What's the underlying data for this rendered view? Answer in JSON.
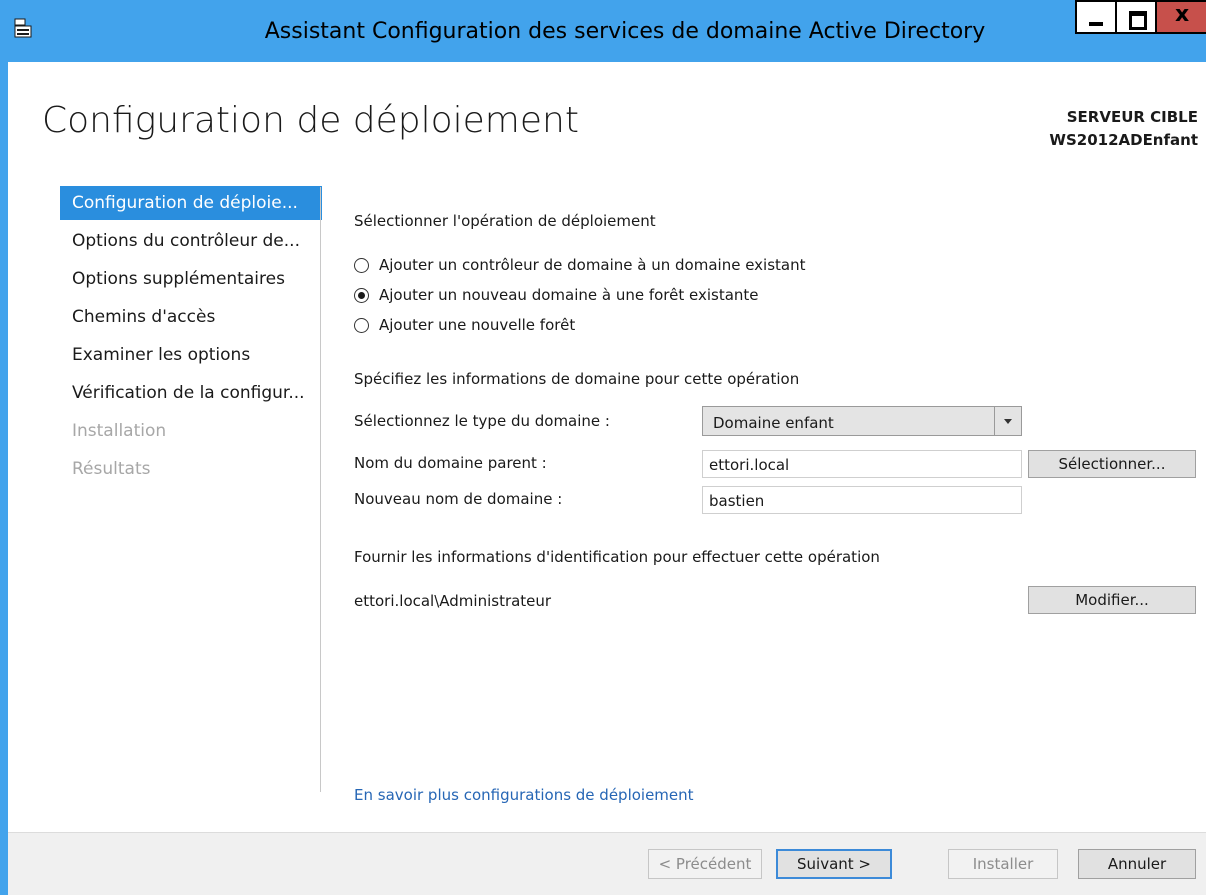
{
  "window": {
    "title": "Assistant Configuration des services de domaine Active Directory",
    "close_glyph": "x"
  },
  "header": {
    "page_title": "Configuration de déploiement",
    "target_label": "SERVEUR CIBLE",
    "target_name": "WS2012ADEnfant"
  },
  "nav": {
    "items": [
      {
        "label": "Configuration de déploie...",
        "state": "selected"
      },
      {
        "label": "Options du contrôleur de...",
        "state": "normal"
      },
      {
        "label": "Options supplémentaires",
        "state": "normal"
      },
      {
        "label": "Chemins d'accès",
        "state": "normal"
      },
      {
        "label": "Examiner les options",
        "state": "normal"
      },
      {
        "label": "Vérification de la configur...",
        "state": "normal"
      },
      {
        "label": "Installation",
        "state": "disabled"
      },
      {
        "label": "Résultats",
        "state": "disabled"
      }
    ]
  },
  "main": {
    "operation_heading": "Sélectionner l'opération de déploiement",
    "radios": [
      {
        "label": "Ajouter un contrôleur de domaine à un domaine existant",
        "checked": false
      },
      {
        "label": "Ajouter un nouveau domaine à une forêt existante",
        "checked": true
      },
      {
        "label": "Ajouter une nouvelle forêt",
        "checked": false
      }
    ],
    "domain_heading": "Spécifiez les informations de domaine pour cette opération",
    "domain_type_label": "Sélectionnez le type du domaine :",
    "domain_type_value": "Domaine enfant",
    "parent_domain_label": "Nom du domaine parent :",
    "parent_domain_value": "ettori.local",
    "select_button": "Sélectionner...",
    "new_domain_label": "Nouveau nom de domaine :",
    "new_domain_value": "bastien",
    "credentials_heading": "Fournir les informations d'identification pour effectuer cette opération",
    "credentials_value": "ettori.local\\Administrateur",
    "modify_button": "Modifier...",
    "learn_more_link": "En savoir plus configurations de déploiement"
  },
  "footer": {
    "previous_button": "< Précédent",
    "next_button": "Suivant >",
    "install_button": "Installer",
    "cancel_button": "Annuler"
  },
  "colors": {
    "titlebar": "#42a3ec",
    "nav_selected": "#2a8ede",
    "link": "#2666b5",
    "close_button": "#c7504b"
  }
}
